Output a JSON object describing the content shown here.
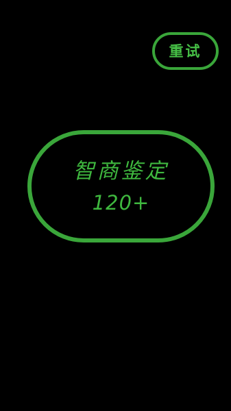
{
  "retry_button": {
    "label": "重试"
  },
  "result": {
    "title": "智商鉴定",
    "score": "120+"
  },
  "colors": {
    "background": "#000000",
    "accent": "#3aa63a",
    "text": "#3fb83f"
  }
}
